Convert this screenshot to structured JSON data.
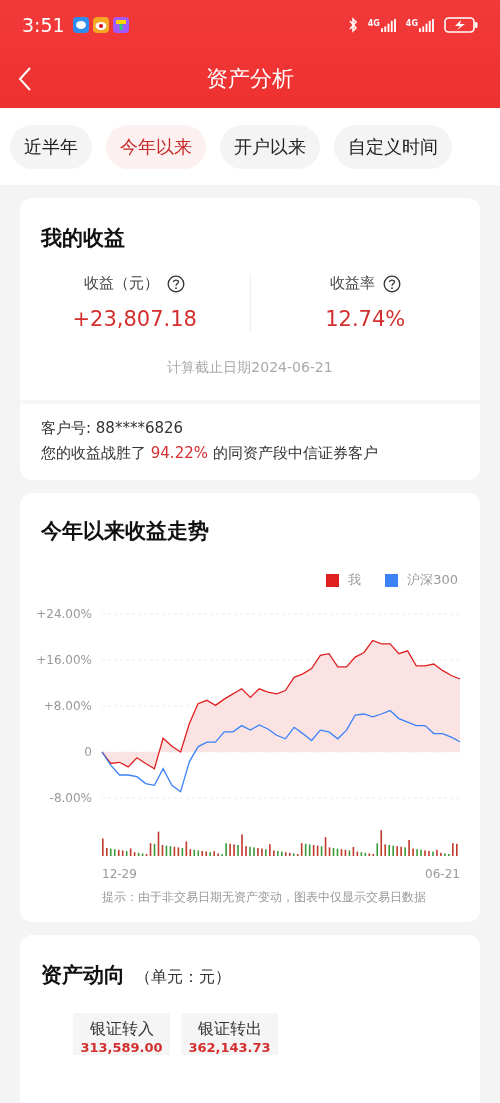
{
  "status_bar": {
    "time": "3:51",
    "network_labels": [
      "4G",
      "4G"
    ]
  },
  "header": {
    "title": "资产分析"
  },
  "tabs": [
    {
      "label": "近半年",
      "selected": false
    },
    {
      "label": "今年以来",
      "selected": true
    },
    {
      "label": "开户以来",
      "selected": false
    },
    {
      "label": "自定义时间",
      "selected": false
    }
  ],
  "earnings_card": {
    "title": "我的收益",
    "metrics": [
      {
        "label": "收益（元）",
        "value": "+23,807.18"
      },
      {
        "label": "收益率",
        "value": "12.74%"
      }
    ],
    "as_of": "计算截止日期2024-06-21",
    "customer_id": "客户号: 88****6826",
    "ranking": [
      {
        "text": "您的收益战胜了 ",
        "highlight": false
      },
      {
        "text": "94.22%",
        "highlight": true
      },
      {
        "text": " 的同资产段中信证券客户",
        "highlight": false
      }
    ]
  },
  "trend_card": {
    "title": "今年以来收益走势",
    "note": "提示：由于非交易日期无资产变动，图表中仅显示交易日数据",
    "chart_data": {
      "type": "line",
      "categories": [
        null,
        null,
        "12-29",
        null,
        null,
        null,
        null,
        null,
        null,
        null,
        null,
        null,
        null,
        null,
        null,
        null,
        null,
        null,
        null,
        null,
        null,
        null,
        null,
        null,
        null,
        null,
        null,
        null,
        null,
        null,
        null,
        null,
        null,
        null,
        null,
        null,
        null,
        null,
        null,
        "06-21",
        null,
        null
      ],
      "ylim": [
        -8,
        24
      ],
      "grid": true,
      "yticks": [
        {
          "value": 24,
          "label": "+24.00%"
        },
        {
          "value": 16,
          "label": "+16.00%"
        },
        {
          "value": 8,
          "label": "+8.00%"
        },
        {
          "value": 0,
          "label": "0"
        },
        {
          "value": -8,
          "label": "-8.00%"
        }
      ],
      "series": [
        {
          "name": "我",
          "color": "#e02020",
          "values": [
            0,
            -2,
            -1.8,
            -2.6,
            -1,
            -2,
            -2.9,
            2.4,
            1,
            0,
            4.9,
            8.4,
            9,
            8.1,
            9.2,
            10.1,
            11,
            9.5,
            11,
            10.4,
            10.1,
            10.7,
            13,
            13.6,
            14.5,
            16.8,
            17.1,
            14.8,
            14.8,
            16.5,
            17.3,
            19.4,
            18.8,
            18.8,
            17.1,
            17.6,
            15,
            15,
            15.3,
            14.2,
            13.3,
            12.7
          ]
        },
        {
          "name": "沪深300",
          "color": "#3b82f6",
          "values": [
            0,
            -2.3,
            -4,
            -4,
            -4.3,
            -5.5,
            -5.8,
            -2.9,
            -5.8,
            -6.9,
            -1.7,
            0.9,
            1.7,
            1.7,
            3.5,
            3.5,
            4.6,
            3.8,
            4.7,
            4,
            2.9,
            2.3,
            4.3,
            3.2,
            2,
            3.8,
            3.5,
            2.3,
            3.8,
            6.4,
            6.6,
            6.1,
            6.6,
            7.2,
            5.8,
            5.2,
            4.6,
            4.6,
            3.2,
            3.2,
            2.6,
            1.8
          ]
        }
      ]
    }
  },
  "flow_card": {
    "title": "资产动向",
    "unit": "（单元：元）",
    "items": [
      {
        "label": "银证转入",
        "value": "313,589.00"
      },
      {
        "label": "银证转出",
        "value": "362,143.73"
      }
    ]
  }
}
